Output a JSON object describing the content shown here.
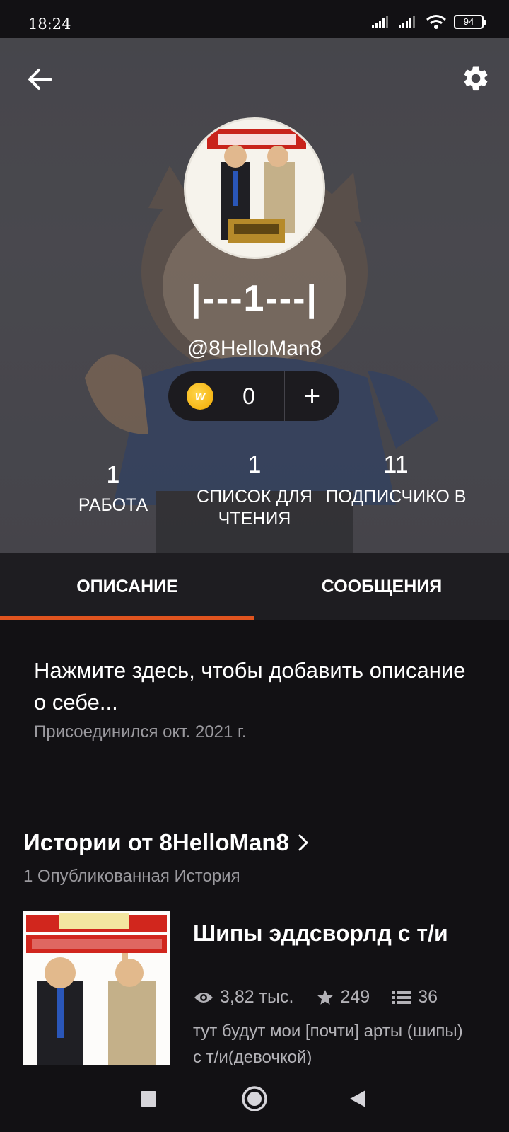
{
  "status_bar": {
    "time": "18:24",
    "battery": "94"
  },
  "header": {
    "icons": {
      "back": "arrow-left-icon",
      "settings": "gear-icon"
    },
    "display_name": "|---1---|",
    "username": "@8HelloMan8",
    "coins": {
      "count": "0",
      "add_label": "+"
    },
    "stats": [
      {
        "value": "1",
        "label": "РАБОТА"
      },
      {
        "value": "1",
        "label": "СПИСОК ДЛЯ ЧТЕНИЯ"
      },
      {
        "value": "11",
        "label": "ПОДПИСЧИКО В"
      }
    ]
  },
  "tabs": [
    {
      "label": "ОПИСАНИЕ",
      "active": true
    },
    {
      "label": "СООБЩЕНИЯ",
      "active": false
    }
  ],
  "about": {
    "placeholder": "Нажмите здесь, чтобы добавить описание о себе...",
    "joined": "Присоединился окт. 2021 г."
  },
  "stories": {
    "title": "Истории от 8HelloMan8",
    "subtitle": "1 Опубликованная История",
    "items": [
      {
        "title": "Шипы эддсворлд с т/и",
        "reads": "3,82 тыс.",
        "votes": "249",
        "parts": "36",
        "description": "тут будут мои [почти] арты (шипы) с т/и(девочкой)"
      }
    ]
  },
  "colors": {
    "accent": "#e0541f",
    "coin": "#f2a900",
    "background": "#121114"
  }
}
